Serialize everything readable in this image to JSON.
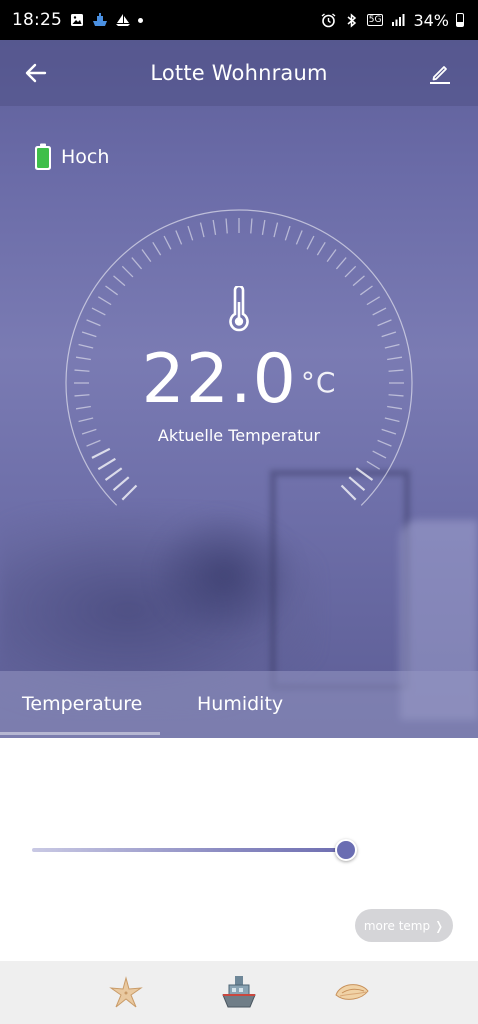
{
  "status_bar": {
    "time": "18:25",
    "network": "5G",
    "battery_percent": "34%"
  },
  "header": {
    "title": "Lotte Wohnraum"
  },
  "battery": {
    "label": "Hoch",
    "color": "#3fbf4a"
  },
  "gauge": {
    "value": "22.0",
    "unit": "°C",
    "label": "Aktuelle Temperatur",
    "tick_count": 60,
    "ticks_highlighted_start": 5
  },
  "tabs": [
    {
      "label": "Temperature",
      "selected": true
    },
    {
      "label": "Humidity",
      "selected": false
    }
  ],
  "slider": {
    "fraction": 0.96,
    "accent": "#6a6db2"
  },
  "more_button": {
    "label": "more temp"
  },
  "bottom_nav": [
    {
      "icon": "starfish-icon"
    },
    {
      "icon": "boat-icon"
    },
    {
      "icon": "shell-icon"
    }
  ],
  "colors": {
    "hero": "#6b6ca8",
    "accent": "#6a6db2"
  }
}
